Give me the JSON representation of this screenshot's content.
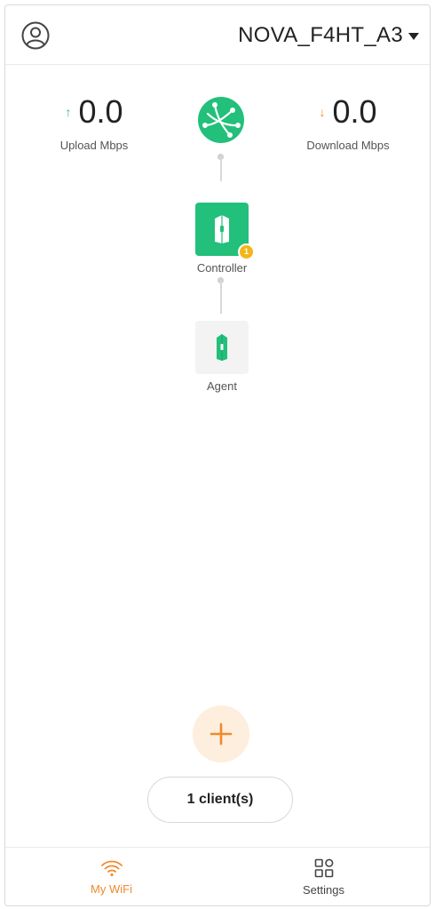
{
  "header": {
    "network_name": "NOVA_F4HT_A3",
    "avatar_icon": "user-circle-icon",
    "dropdown_icon": "caret-down-icon"
  },
  "speed": {
    "upload": {
      "value": "0.0",
      "label": "Upload Mbps",
      "icon": "arrow-up-icon",
      "color": "#1fc27b"
    },
    "download": {
      "value": "0.0",
      "label": "Download Mbps",
      "icon": "arrow-down-icon",
      "color": "#f08a2c"
    }
  },
  "topology": {
    "internet_icon": "globe-icon",
    "controller": {
      "label": "Controller",
      "badge": "1",
      "color": "#22c07a"
    },
    "agent": {
      "label": "Agent"
    }
  },
  "actions": {
    "add_icon": "plus-icon",
    "clients_label": "1 client(s)"
  },
  "tabbar": {
    "tabs": [
      {
        "label": "My WiFi",
        "icon": "wifi-icon",
        "active": true
      },
      {
        "label": "Settings",
        "icon": "grid-icon",
        "active": false
      }
    ]
  },
  "colors": {
    "accent": "#f08a2c",
    "brand_green": "#22c07a",
    "badge": "#f5b419"
  }
}
